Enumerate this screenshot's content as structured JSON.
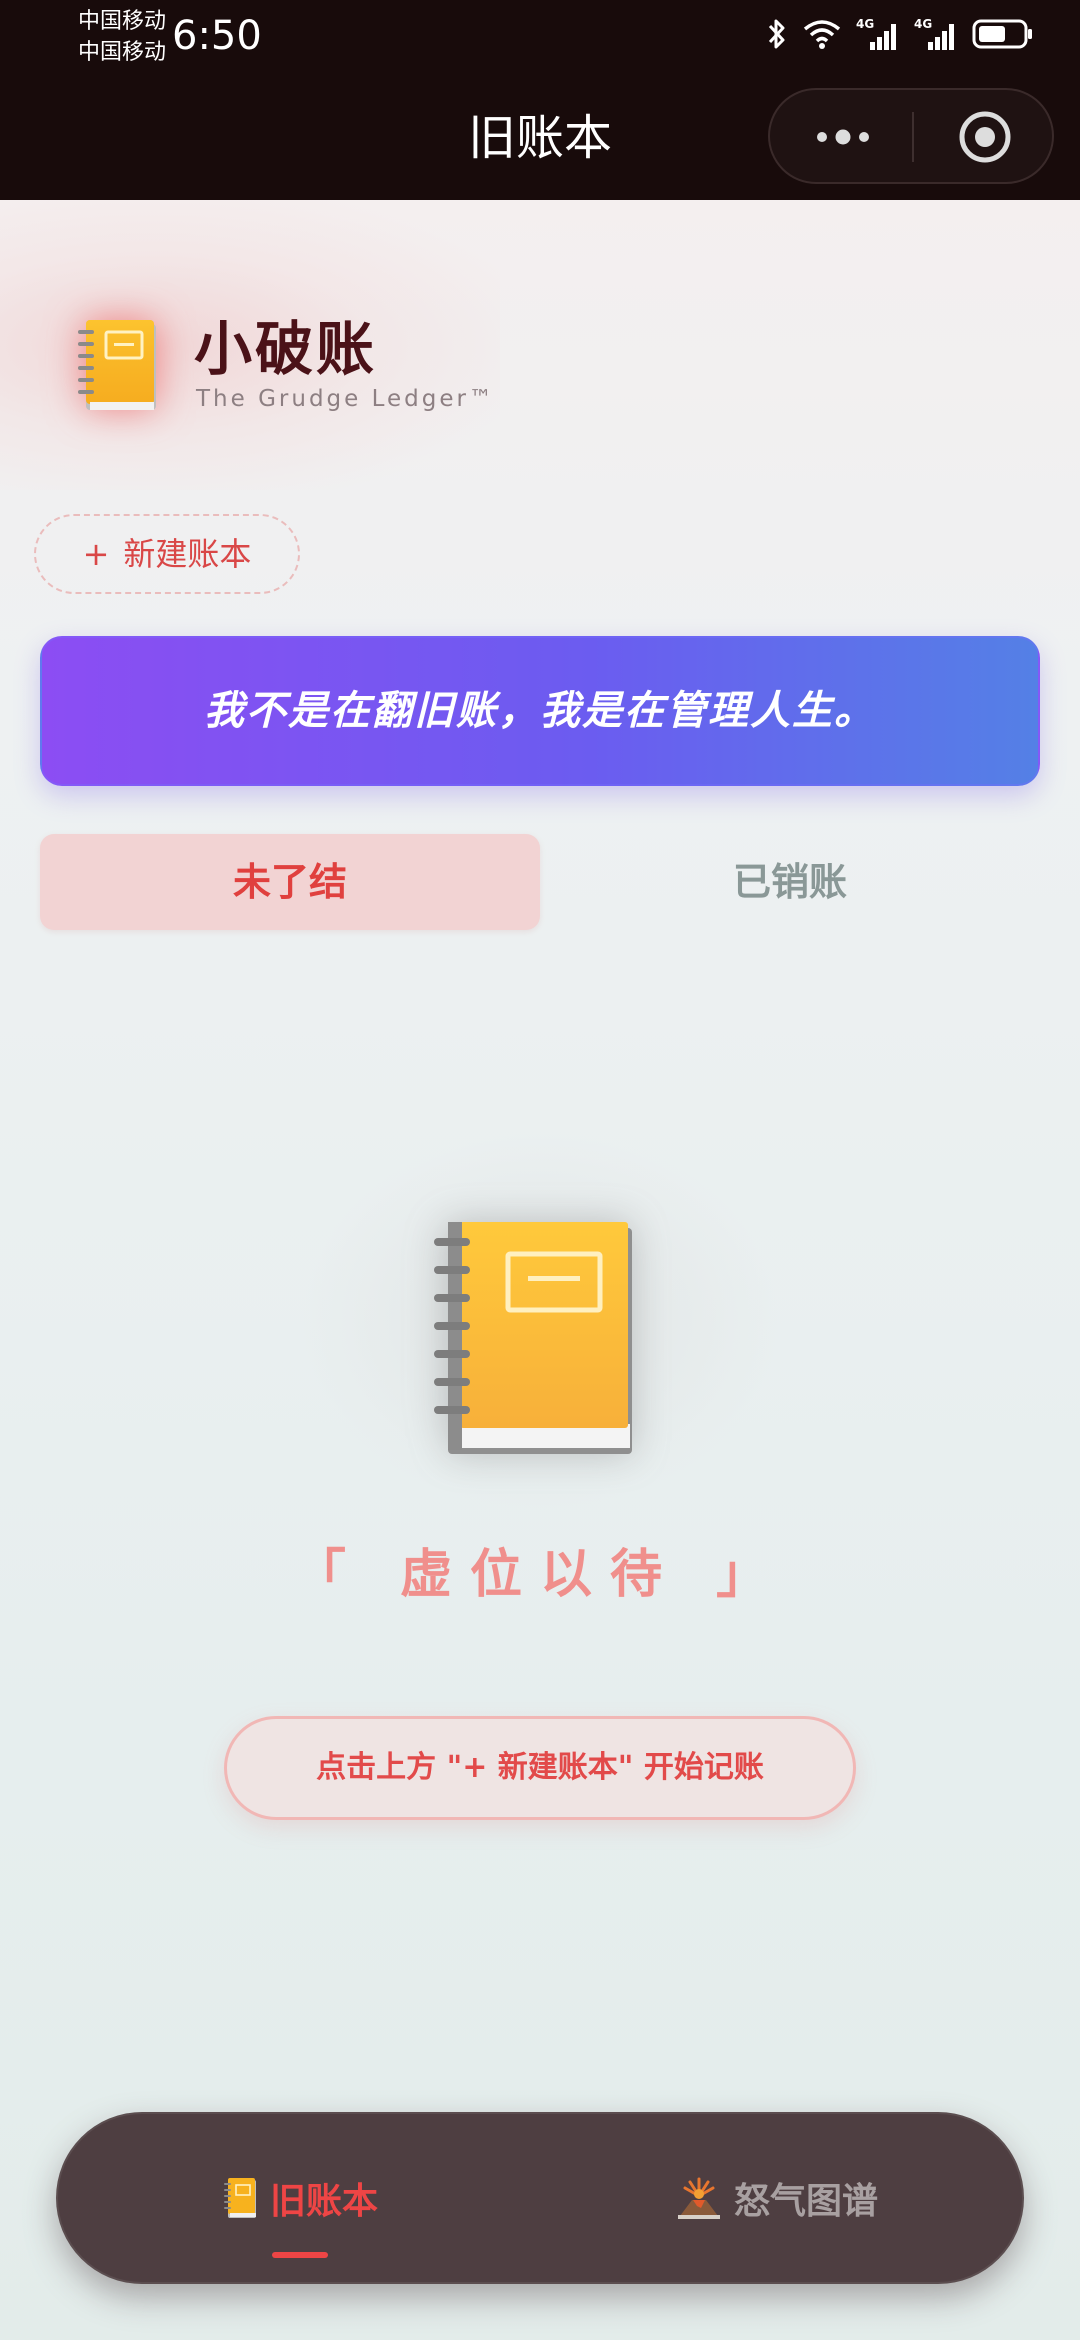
{
  "status_bar": {
    "carrier_1": "中国移动",
    "carrier_2": "中国移动",
    "time": "6:50",
    "network_1": "4G",
    "network_2": "4G"
  },
  "nav": {
    "title": "旧账本"
  },
  "header": {
    "app_name": "小破账",
    "tagline": "The Grudge Ledger™"
  },
  "actions": {
    "new_ledger_plus": "+",
    "new_ledger_label": "新建账本"
  },
  "motto": {
    "text": "我不是在翻旧账，我是在管理人生。"
  },
  "tabs": [
    {
      "label": "未了结",
      "active": true
    },
    {
      "label": "已销账",
      "active": false
    }
  ],
  "empty_state": {
    "caption": "「 虚位以待 」",
    "hint": "点击上方 \"+ 新建账本\" 开始记账"
  },
  "bottom_nav": [
    {
      "icon": "notebook-icon",
      "label": "旧账本",
      "active": true
    },
    {
      "icon": "volcano-icon",
      "label": "怒气图谱",
      "active": false
    }
  ],
  "colors": {
    "accent_red": "#e0403e",
    "motto_gradient_start": "#8c4df3",
    "motto_gradient_end": "#5480e6",
    "status_bar_bg": "#180b0b",
    "bottom_bar_bg": "#4e3e41"
  }
}
